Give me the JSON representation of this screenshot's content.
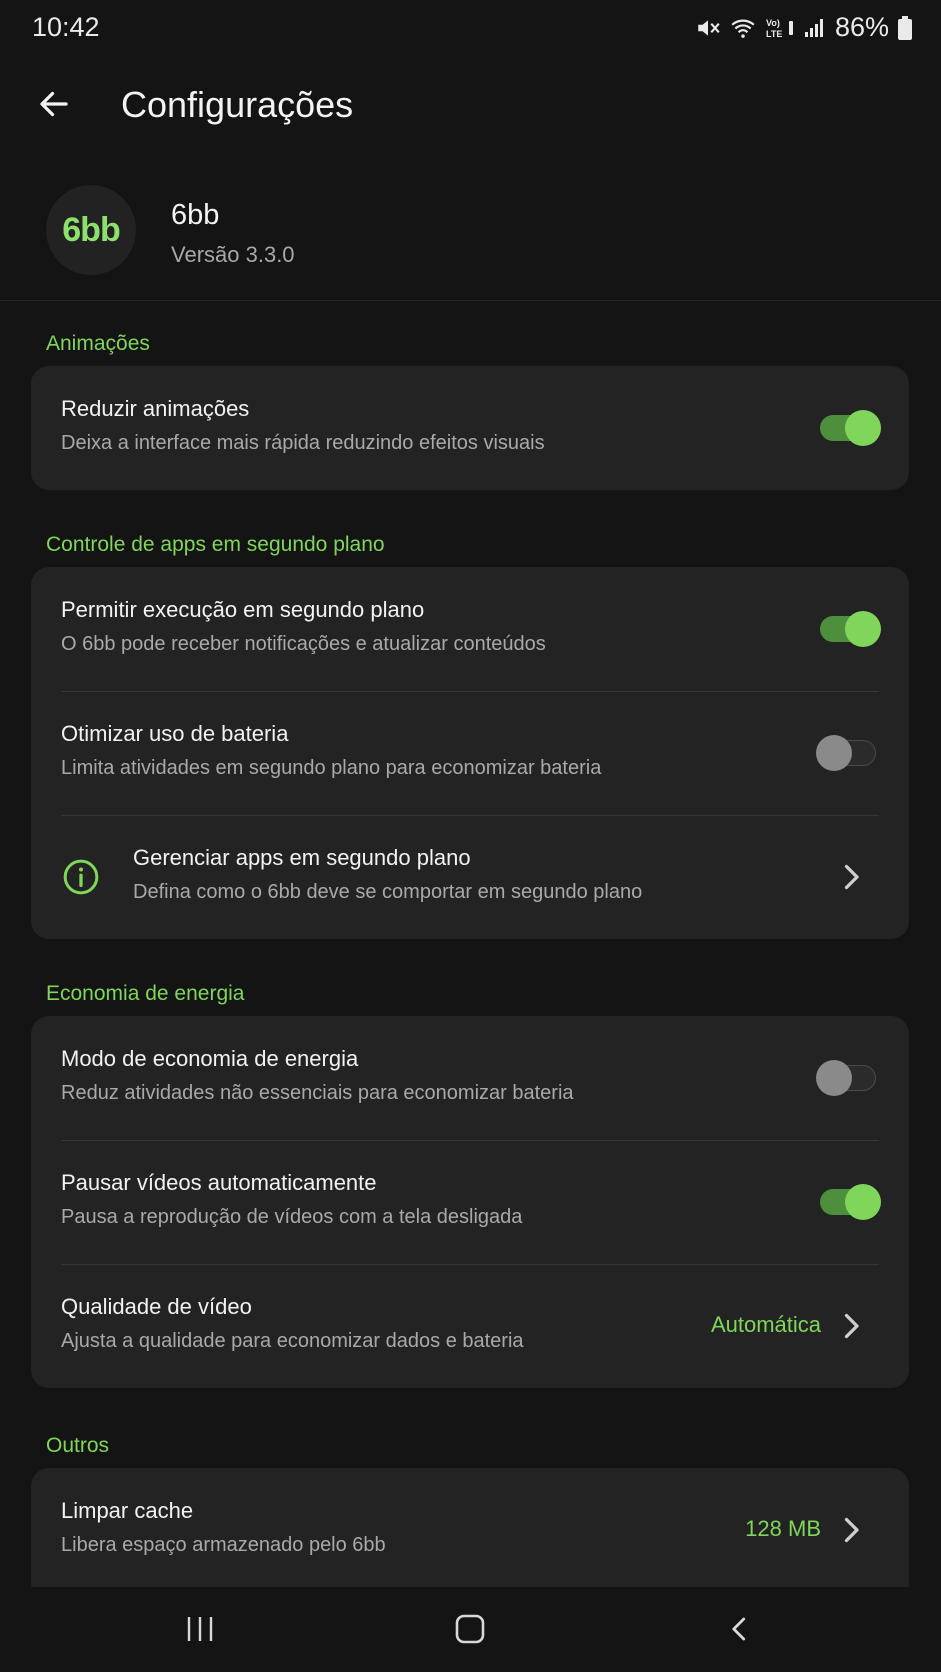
{
  "status_bar": {
    "time": "10:42",
    "battery_percent": "86%",
    "icons": [
      "mute-icon",
      "wifi-icon",
      "volte-icon",
      "signal-icon",
      "battery-icon"
    ]
  },
  "app_bar": {
    "title": "Configurações"
  },
  "app_info": {
    "logo_text": "6bb",
    "name": "6bb",
    "version": "Versão 3.3.0"
  },
  "sections": {
    "animations": {
      "title": "Animações",
      "reduce_animations": {
        "title": "Reduzir animações",
        "subtitle": "Deixa a interface mais rápida reduzindo efeitos visuais",
        "enabled": true
      }
    },
    "background": {
      "title": "Controle de apps em segundo plano",
      "allow_background": {
        "title": "Permitir execução em segundo plano",
        "subtitle": "O 6bb pode receber notificações e atualizar conteúdos",
        "enabled": true
      },
      "optimize_battery": {
        "title": "Otimizar uso de bateria",
        "subtitle": "Limita atividades em segundo plano para economizar bateria",
        "enabled": false
      },
      "manage_background": {
        "title": "Gerenciar apps em segundo plano",
        "subtitle": "Defina como o 6bb deve se comportar em segundo plano",
        "icon": "info-icon"
      }
    },
    "energy": {
      "title": "Economia de energia",
      "power_saving": {
        "title": "Modo de economia de energia",
        "subtitle": "Reduz atividades não essenciais para economizar bateria",
        "enabled": false
      },
      "auto_pause": {
        "title": "Pausar vídeos automaticamente",
        "subtitle": "Pausa a reprodução de vídeos com a tela desligada",
        "enabled": true
      },
      "video_quality": {
        "title": "Qualidade de vídeo",
        "subtitle": "Ajusta a qualidade para economizar dados e bateria",
        "value": "Automática"
      }
    },
    "others": {
      "title": "Outros",
      "clear_cache": {
        "title": "Limpar cache",
        "subtitle": "Libera espaço armazenado pelo 6bb",
        "value": "128 MB"
      }
    }
  },
  "colors": {
    "accent": "#7fd65a",
    "background": "#141414",
    "card": "#232323"
  },
  "nav_bar": {
    "buttons": [
      "recents-icon",
      "home-icon",
      "back-icon"
    ]
  }
}
